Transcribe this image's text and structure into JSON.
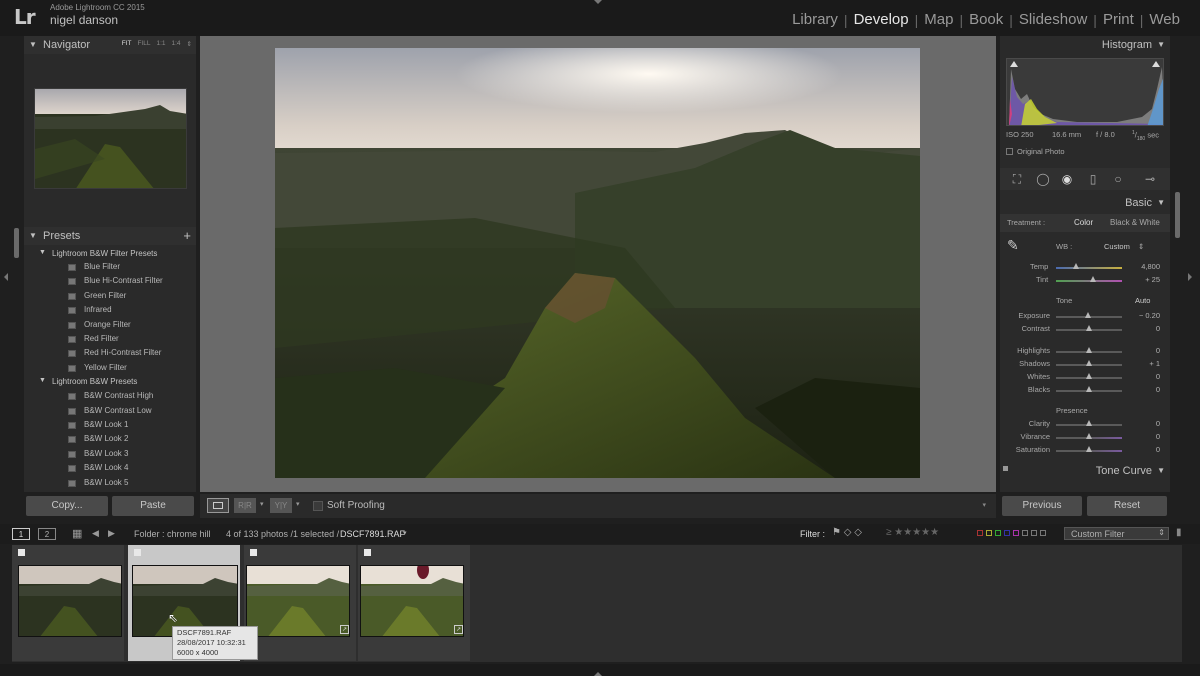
{
  "app": {
    "name": "Adobe Lightroom CC 2015",
    "user": "nigel danson"
  },
  "modules": [
    {
      "label": "Library",
      "active": false
    },
    {
      "label": "Develop",
      "active": true
    },
    {
      "label": "Map",
      "active": false
    },
    {
      "label": "Book",
      "active": false
    },
    {
      "label": "Slideshow",
      "active": false
    },
    {
      "label": "Print",
      "active": false
    },
    {
      "label": "Web",
      "active": false
    }
  ],
  "navigator": {
    "title": "Navigator",
    "zoom": [
      "FIT",
      "FILL",
      "1:1",
      "1:4"
    ]
  },
  "presets": {
    "title": "Presets",
    "add_icon": "+",
    "folders": [
      {
        "label": "Lightroom B&W Filter Presets",
        "items": [
          "Blue Filter",
          "Blue Hi-Contrast Filter",
          "Green Filter",
          "Infrared",
          "Orange Filter",
          "Red Filter",
          "Red Hi-Contrast Filter",
          "Yellow Filter"
        ]
      },
      {
        "label": "Lightroom B&W Presets",
        "items": [
          "B&W Contrast High",
          "B&W Contrast Low",
          "B&W Look 1",
          "B&W Look 2",
          "B&W Look 3",
          "B&W Look 4",
          "B&W Look 5"
        ]
      }
    ]
  },
  "left_buttons": {
    "copy": "Copy...",
    "paste": "Paste"
  },
  "toolbar": {
    "soft_proofing": "Soft Proofing"
  },
  "histogram": {
    "title": "Histogram",
    "iso": "ISO 250",
    "focal": "16.6 mm",
    "aperture": "f / 8.0",
    "shutter_num": "1",
    "shutter_den": "180",
    "shutter_unit": "sec",
    "original_photo": "Original Photo"
  },
  "basic": {
    "title": "Basic",
    "treatment_label": "Treatment :",
    "treatment_color": "Color",
    "treatment_bw": "Black & White",
    "wb_label": "WB :",
    "wb_value": "Custom",
    "temp_label": "Temp",
    "temp_value": "4,800",
    "tint_label": "Tint",
    "tint_value": "+ 25",
    "tone_label": "Tone",
    "tone_auto": "Auto",
    "sliders": [
      {
        "label": "Exposure",
        "value": "− 0.20",
        "pos": 0.48
      },
      {
        "label": "Contrast",
        "value": "0",
        "pos": 0.5
      },
      {
        "label": "Highlights",
        "value": "0",
        "pos": 0.5
      },
      {
        "label": "Shadows",
        "value": "+ 1",
        "pos": 0.5
      },
      {
        "label": "Whites",
        "value": "0",
        "pos": 0.5
      },
      {
        "label": "Blacks",
        "value": "0",
        "pos": 0.5
      }
    ],
    "presence_label": "Presence",
    "presence": [
      {
        "label": "Clarity",
        "value": "0",
        "pos": 0.5
      },
      {
        "label": "Vibrance",
        "value": "0",
        "pos": 0.5
      },
      {
        "label": "Saturation",
        "value": "0",
        "pos": 0.5
      }
    ]
  },
  "tone_curve": {
    "title": "Tone Curve"
  },
  "right_buttons": {
    "previous": "Previous",
    "reset": "Reset"
  },
  "filmbar": {
    "page1": "1",
    "page2": "2",
    "folder": "Folder : chrome hill",
    "count": "4 of 133 photos /1 selected /",
    "filename": "DSCF7891.RAF",
    "filter_label": "Filter :",
    "custom_filter": "Custom Filter"
  },
  "tooltip": {
    "line1": "DSCF7891.RAF",
    "line2": "28/08/2017 10:32:31",
    "line3": "6000 x 4000"
  }
}
